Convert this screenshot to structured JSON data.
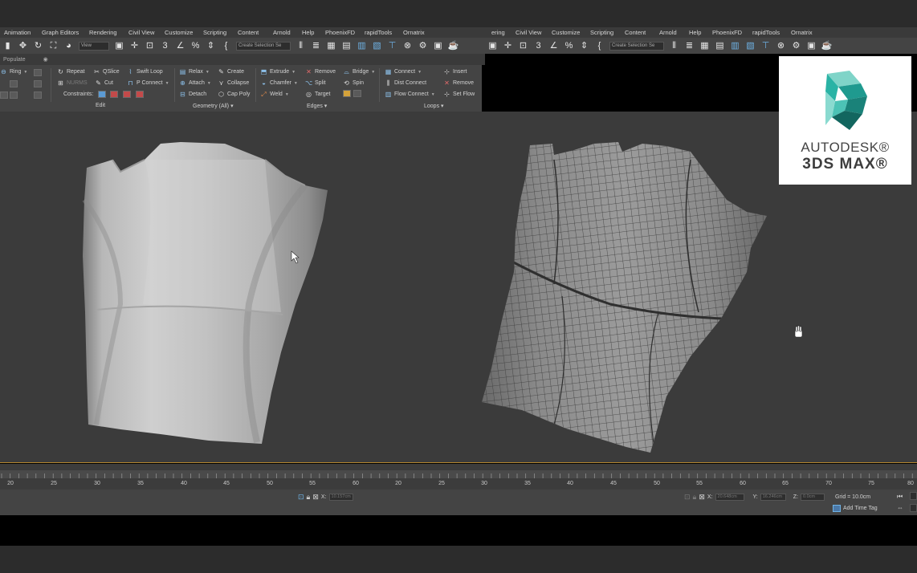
{
  "menus": {
    "left": [
      "Animation",
      "Graph Editors",
      "Rendering",
      "Civil View",
      "Customize",
      "Scripting",
      "Content",
      "Arnold",
      "Help",
      "PhoenixFD",
      "rapidTools",
      "Ornatrix"
    ],
    "right": [
      "ering",
      "Civil View",
      "Customize",
      "Scripting",
      "Content",
      "Arnold",
      "Help",
      "PhoenixFD",
      "rapidTools",
      "Ornatrix"
    ]
  },
  "toolbar": {
    "view_dropdown": "View",
    "selection_set_left": "Create Selection Se",
    "selection_set_right": "Create Selection Se"
  },
  "populate_label": "Populate",
  "ribbon": {
    "ring": "Ring",
    "repeat": "Repeat",
    "qslice": "QSlice",
    "swift_loop": "Swift Loop",
    "nurms": "NURMS",
    "cut": "Cut",
    "p_connect": "P Connect",
    "constraints": "Constraints:",
    "edit_panel": "Edit",
    "relax": "Relax",
    "create": "Create",
    "attach": "Attach",
    "collapse": "Collapse",
    "detach": "Detach",
    "cap_poly": "Cap Poly",
    "geometry_panel": "Geometry (All)",
    "extrude": "Extrude",
    "remove": "Remove",
    "bridge": "Bridge",
    "chamfer": "Chamfer",
    "split": "Split",
    "spin": "Spin",
    "weld": "Weld",
    "target": "Target",
    "edges_panel": "Edges",
    "connect": "Connect",
    "insert": "Insert",
    "dist_connect": "Dist Connect",
    "remove_loop": "Remove",
    "flow_connect": "Flow Connect",
    "set_flow": "Set Flow",
    "loops_panel": "Loops"
  },
  "logo": {
    "line1": "AUTODESK®",
    "line2": "3DS MAX®"
  },
  "timeline": {
    "ticks_left": [
      "20",
      "25",
      "30",
      "35",
      "40",
      "45",
      "50",
      "55",
      "60"
    ],
    "ticks_right": [
      "20",
      "25",
      "30",
      "35",
      "40",
      "45",
      "50",
      "55",
      "60",
      "65",
      "70",
      "75",
      "80"
    ]
  },
  "status": {
    "x_label": "X:",
    "x_value_left": "10.157cm",
    "x_value_right": "20.648cm",
    "y_label": "Y:",
    "y_value": "16.246cm",
    "z_label": "Z:",
    "z_value": "0.0cm",
    "grid": "Grid = 10.0cm",
    "add_time_tag": "Add Time Tag"
  },
  "colors": {
    "viewport_bg": "#3b3b3b",
    "ribbon_bg": "#444444",
    "accent_blue": "#6fb3e6",
    "timeline_border": "#b5862e"
  }
}
